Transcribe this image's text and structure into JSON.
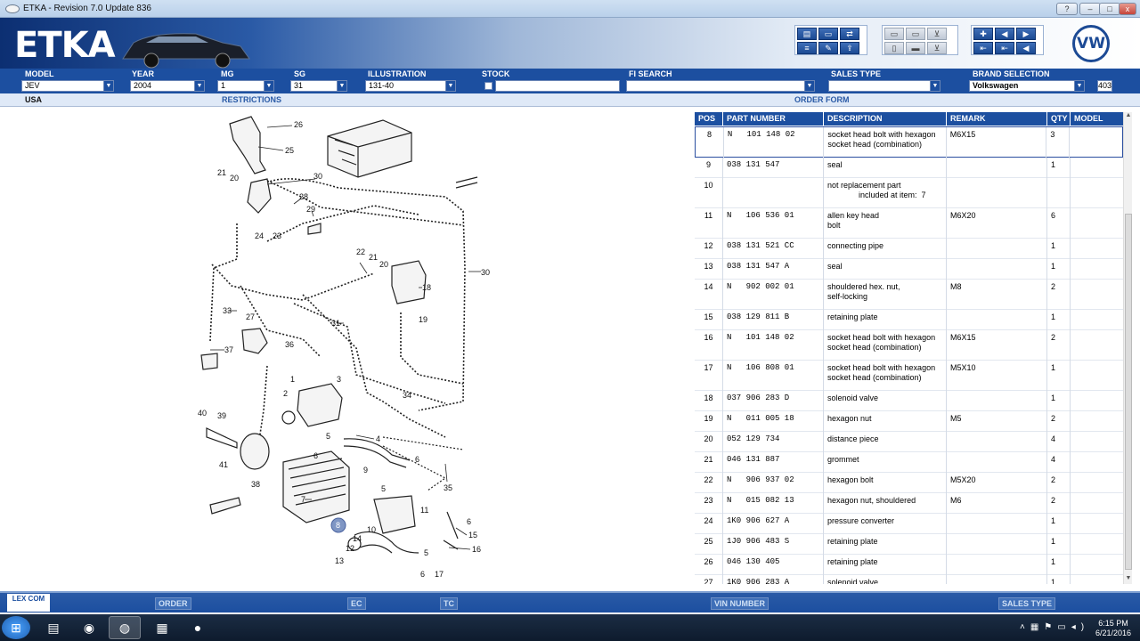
{
  "window": {
    "title": "ETKA - Revision 7.0 Update 836"
  },
  "header": {
    "brand": "ETKA",
    "vw_logo": "VW"
  },
  "fields": {
    "model": {
      "label": "MODEL",
      "value": "JEV"
    },
    "year": {
      "label": "YEAR",
      "value": "2004"
    },
    "mg": {
      "label": "MG",
      "value": "1"
    },
    "sg": {
      "label": "SG",
      "value": "31"
    },
    "illustration": {
      "label": "ILLUSTRATION",
      "value": "131-40"
    },
    "stock": {
      "label": "STOCK"
    },
    "fi_search": {
      "label": "FI SEARCH",
      "value": ""
    },
    "sales_type": {
      "label": "SALES TYPE",
      "value": ""
    },
    "brand_selection": {
      "label": "BRAND SELECTION",
      "value": "Volkswagen"
    },
    "brand_count": "403"
  },
  "infobar": {
    "region": "USA",
    "restrictions": "RESTRICTIONS",
    "order_form": "ORDER FORM"
  },
  "table": {
    "headers": [
      "POS",
      "PART NUMBER",
      "DESCRIPTION",
      "REMARK",
      "QTY",
      "MODEL"
    ],
    "rows": [
      {
        "pos": "8",
        "part": "N   101 148 02",
        "desc": "socket head bolt with hexagon socket head (combination)",
        "remark": "M6X15",
        "qty": "3"
      },
      {
        "pos": "9",
        "part": "038 131 547",
        "desc": "seal",
        "remark": "",
        "qty": "1"
      },
      {
        "pos": "10",
        "part": "",
        "desc": "not replacement part\n              included at item:  7",
        "remark": "",
        "qty": ""
      },
      {
        "pos": "11",
        "part": "N   106 536 01",
        "desc": "allen key head\nbolt",
        "remark": "M6X20",
        "qty": "6"
      },
      {
        "pos": "12",
        "part": "038 131 521 CC",
        "desc": "connecting pipe",
        "remark": "",
        "qty": "1"
      },
      {
        "pos": "13",
        "part": "038 131 547 A",
        "desc": "seal",
        "remark": "",
        "qty": "1"
      },
      {
        "pos": "14",
        "part": "N   902 002 01",
        "desc": "shouldered hex. nut,\nself-locking",
        "remark": "M8",
        "qty": "2"
      },
      {
        "pos": "15",
        "part": "038 129 811 B",
        "desc": "retaining plate",
        "remark": "",
        "qty": "1"
      },
      {
        "pos": "16",
        "part": "N   101 148 02",
        "desc": "socket head bolt with hexagon socket head (combination)",
        "remark": "M6X15",
        "qty": "2"
      },
      {
        "pos": "17",
        "part": "N   106 808 01",
        "desc": "socket head bolt with hexagon socket head (combination)",
        "remark": "M5X10",
        "qty": "1"
      },
      {
        "pos": "18",
        "part": "037 906 283 D",
        "desc": "solenoid valve",
        "remark": "",
        "qty": "1"
      },
      {
        "pos": "19",
        "part": "N   011 005 18",
        "desc": "hexagon nut",
        "remark": "M5",
        "qty": "2"
      },
      {
        "pos": "20",
        "part": "052 129 734",
        "desc": "distance piece",
        "remark": "",
        "qty": "4"
      },
      {
        "pos": "21",
        "part": "046 131 887",
        "desc": "grommet",
        "remark": "",
        "qty": "4"
      },
      {
        "pos": "22",
        "part": "N   906 937 02",
        "desc": "hexagon bolt",
        "remark": "M5X20",
        "qty": "2"
      },
      {
        "pos": "23",
        "part": "N   015 082 13",
        "desc": "hexagon nut, shouldered",
        "remark": "M6",
        "qty": "2"
      },
      {
        "pos": "24",
        "part": "1K0 906 627 A",
        "desc": "pressure converter",
        "remark": "",
        "qty": "1"
      },
      {
        "pos": "25",
        "part": "1J0 906 483 S",
        "desc": "retaining plate",
        "remark": "",
        "qty": "1"
      },
      {
        "pos": "26",
        "part": "046 130 405",
        "desc": "retaining plate",
        "remark": "",
        "qty": "1"
      },
      {
        "pos": "27",
        "part": "1K0 906 283 A",
        "desc": "solenoid valve",
        "remark": "",
        "qty": "1"
      }
    ]
  },
  "diagram": {
    "callouts": [
      "1",
      "2",
      "3",
      "4",
      "5",
      "5",
      "5",
      "6",
      "6",
      "6",
      "6",
      "7",
      "8",
      "9",
      "10",
      "11",
      "12",
      "13",
      "14",
      "15",
      "16",
      "17",
      "18",
      "19",
      "20",
      "20",
      "21",
      "21",
      "22",
      "23",
      "24",
      "25",
      "26",
      "27",
      "28",
      "29",
      "30",
      "30",
      "31",
      "32",
      "33",
      "34",
      "35",
      "36",
      "37",
      "38",
      "39",
      "40",
      "41"
    ],
    "selected": "8"
  },
  "footer": {
    "lex": "LEX COM",
    "order": "ORDER",
    "ec": "EC",
    "tc": "TC",
    "vin": "VIN NUMBER",
    "sales_type": "SALES TYPE"
  },
  "taskbar": {
    "time": "6:15 PM",
    "date": "6/21/2016"
  },
  "colors": {
    "accent": "#1c4fa0",
    "header_dark": "#0c2f72"
  }
}
